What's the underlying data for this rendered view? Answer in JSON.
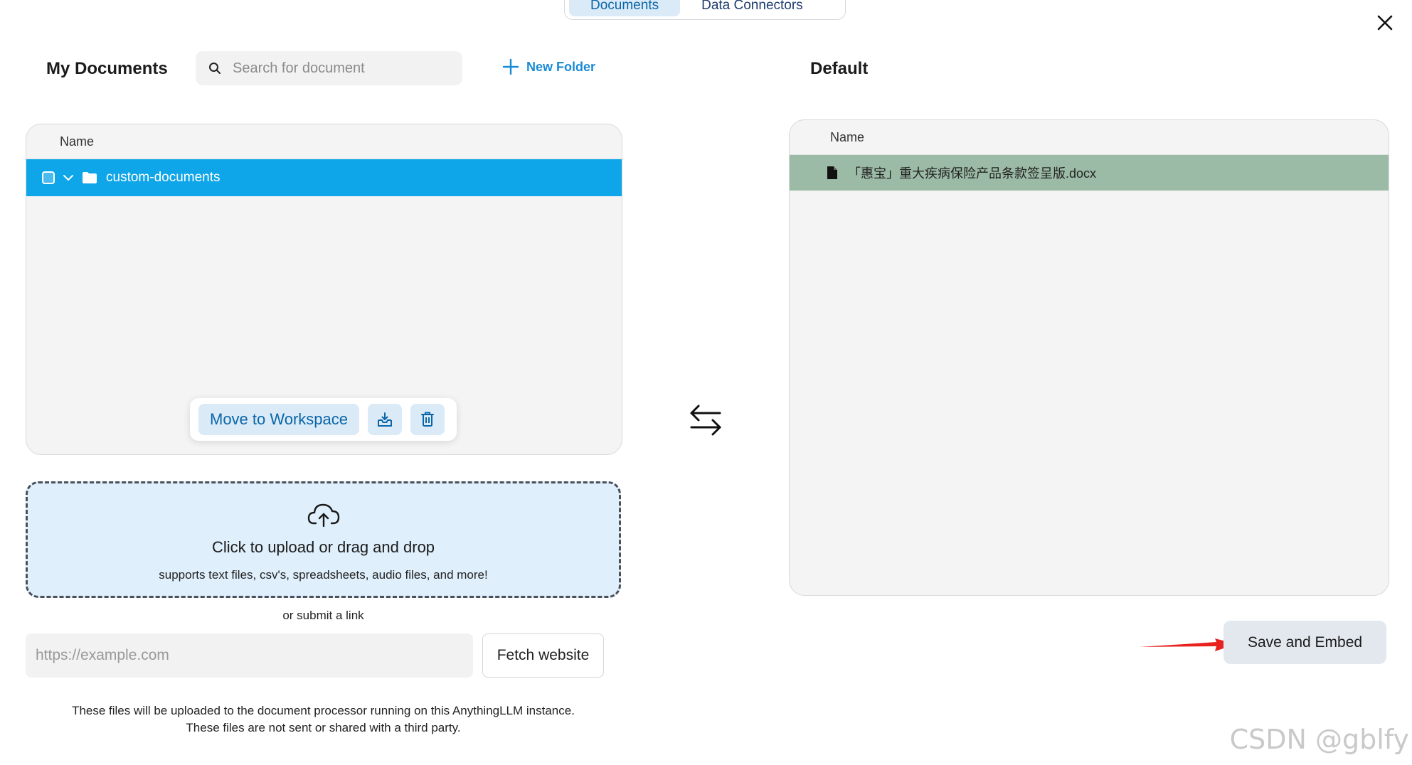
{
  "tabs": [
    {
      "label": "Documents",
      "active": true
    },
    {
      "label": "Data Connectors",
      "active": false
    }
  ],
  "left": {
    "heading": "My Documents",
    "search_placeholder": "Search for document",
    "new_folder_label": "New Folder",
    "column_name": "Name",
    "rows": [
      {
        "name": "custom-documents",
        "type": "folder",
        "selected": true
      }
    ],
    "toolbar": {
      "move_label": "Move to Workspace",
      "save_icon": "download-tray-icon",
      "delete_icon": "trash-icon"
    }
  },
  "right": {
    "heading": "Default",
    "column_name": "Name",
    "files": [
      {
        "name": "「惠宝」重大疾病保险产品条款签呈版.docx",
        "type": "file"
      }
    ]
  },
  "upload": {
    "title": "Click to upload or drag and drop",
    "subtitle": "supports text files, csv's, spreadsheets, audio files, and more!",
    "or_link": "or submit a link",
    "link_placeholder": "https://example.com",
    "fetch_label": "Fetch website",
    "notice_line1": "These files will be uploaded to the document processor running on this AnythingLLM instance.",
    "notice_line2": "These files are not sent or shared with a third party."
  },
  "save_embed_label": "Save and Embed",
  "watermark": "CSDN @gblfy",
  "colors": {
    "selected_row": "#0ea5e9",
    "workspace_file_row": "#9cbba6",
    "accent": "#1a8bd6",
    "annotation_arrow": "#e8231f"
  }
}
